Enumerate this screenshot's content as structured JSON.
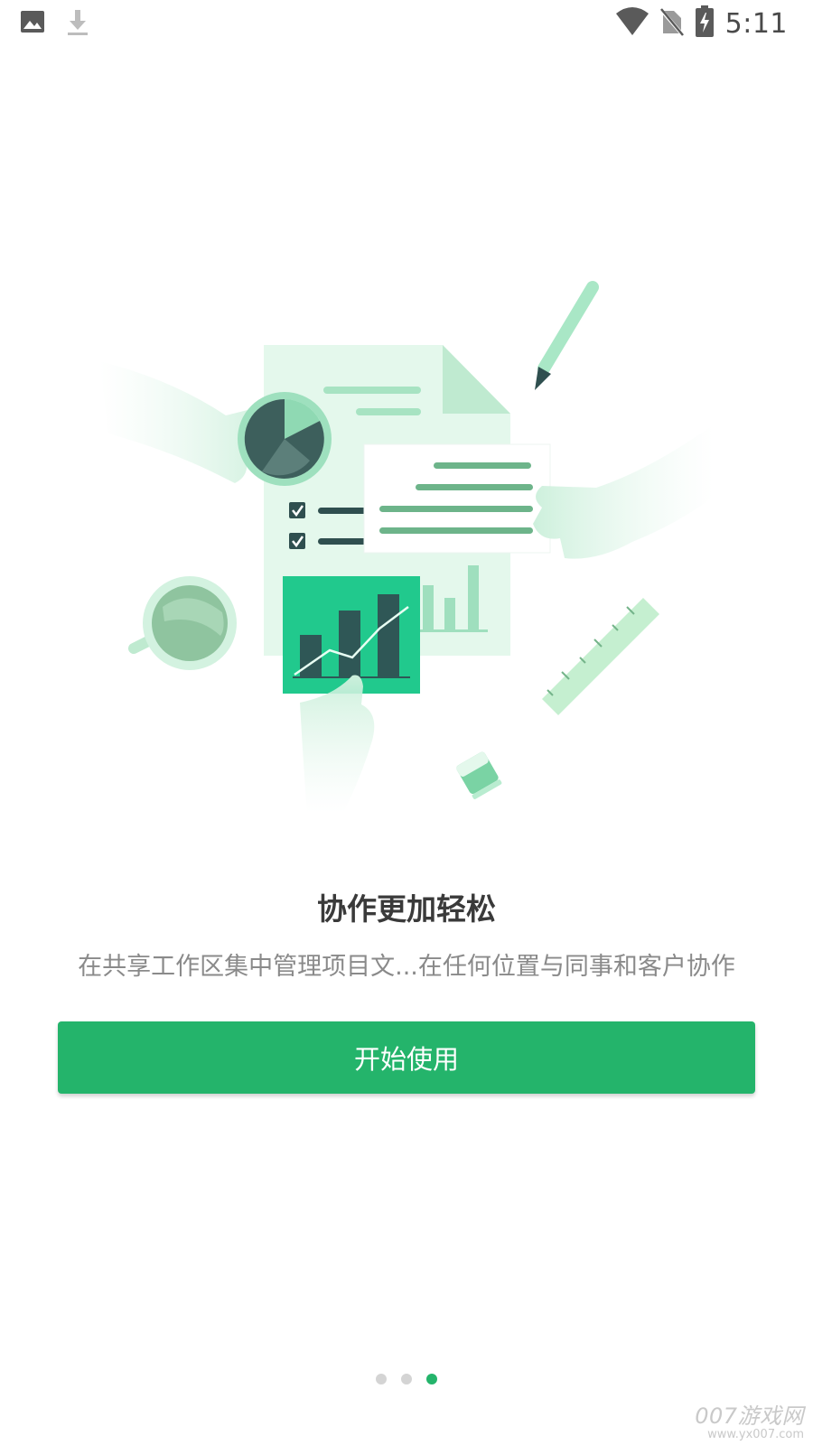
{
  "status_bar": {
    "time": "5:11",
    "left_icons": [
      "image-icon",
      "download-icon"
    ],
    "right_icons": [
      "wifi-icon",
      "no-sim-icon",
      "battery-charging-icon"
    ]
  },
  "onboarding": {
    "title": "协作更加轻松",
    "subtitle": "在共享工作区集中管理项目文...在任何位置与同事和客户协作",
    "button_label": "开始使用",
    "page_indicator": {
      "total": 3,
      "active_index": 2
    }
  },
  "watermark": {
    "main": "007游戏网",
    "url": "www.yx007.com"
  },
  "colors": {
    "accent": "#24b46b",
    "title": "#3a3a3a",
    "subtitle": "#8a8a8a",
    "dot_inactive": "#d4d4d4"
  }
}
